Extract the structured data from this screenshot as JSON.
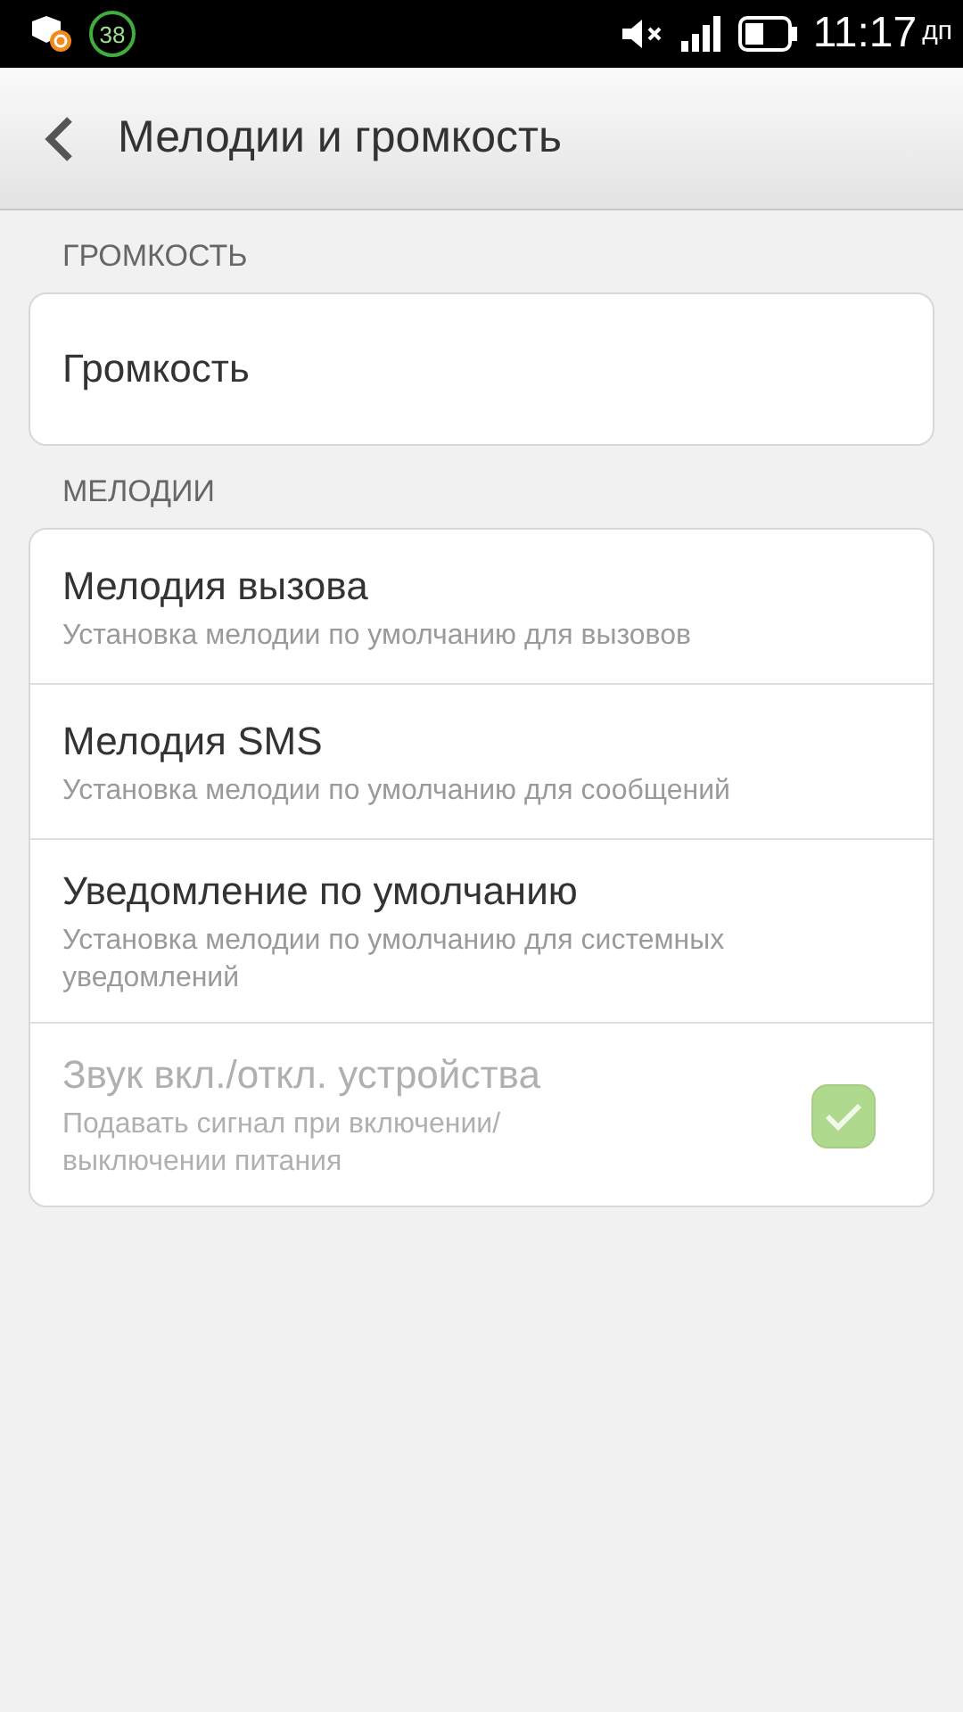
{
  "status_bar": {
    "badge": "38",
    "time": "11:17",
    "time_suffix": "дп"
  },
  "header": {
    "title": "Мелодии и громкость"
  },
  "sections": [
    {
      "label": "ГРОМКОСТЬ",
      "items": [
        {
          "kind": "text",
          "title": "Громкость",
          "disabled": false
        }
      ]
    },
    {
      "label": "МЕЛОДИИ",
      "items": [
        {
          "kind": "text",
          "title": "Мелодия вызова",
          "subtitle": "Установка мелодии по умолчанию для вызовов",
          "disabled": false
        },
        {
          "kind": "text",
          "title": "Мелодия SMS",
          "subtitle": "Установка мелодии по умолчанию для сообщений",
          "disabled": false
        },
        {
          "kind": "text",
          "title": "Уведомление по умолчанию",
          "subtitle": "Установка мелодии по умолчанию для системных уведомлений",
          "disabled": false
        },
        {
          "kind": "checkbox",
          "title": "Звук вкл./откл. устройства",
          "subtitle": "Подавать сигнал при включении/ выключении питания",
          "disabled": true,
          "checked": true
        }
      ]
    }
  ]
}
